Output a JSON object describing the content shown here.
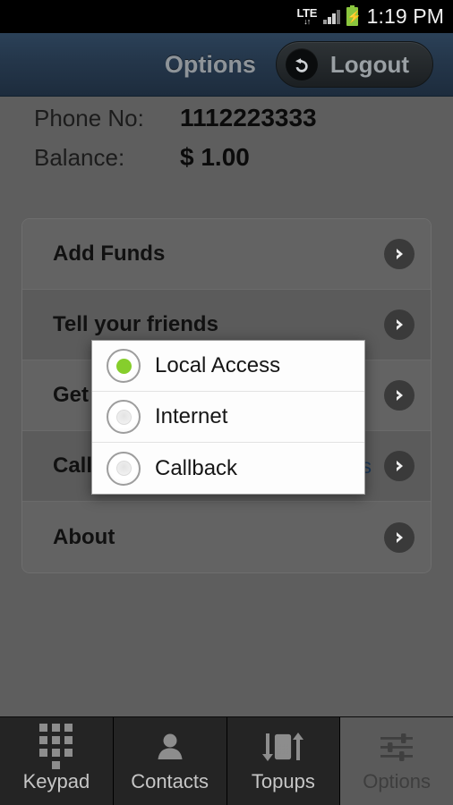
{
  "status_bar": {
    "network_type": "LTE",
    "network_arrows": "↓↑",
    "time": "1:19 PM",
    "battery_icon": "battery-charging-icon",
    "signal_icon": "signal-bars-icon"
  },
  "action_bar": {
    "title": "Options",
    "logout_label": "Logout",
    "logout_icon": "undo-arrow-icon"
  },
  "account": {
    "phone_label": "Phone No:",
    "phone_value": "1112223333",
    "balance_label": "Balance:",
    "balance_value": "$ 1.00"
  },
  "options_list": [
    {
      "label": "Add Funds",
      "value": "",
      "chevron": "chevron-right-icon"
    },
    {
      "label": "Tell your friends",
      "value": "",
      "chevron": "chevron-right-icon"
    },
    {
      "label": "Get Rates",
      "value": "",
      "chevron": "chevron-right-icon"
    },
    {
      "label": "Call Options",
      "value": "Local Access",
      "chevron": "chevron-right-icon"
    },
    {
      "label": "About",
      "value": "",
      "chevron": "chevron-right-icon"
    }
  ],
  "dialog": {
    "options": [
      {
        "label": "Local Access",
        "selected": true
      },
      {
        "label": "Internet",
        "selected": false
      },
      {
        "label": "Callback",
        "selected": false
      }
    ],
    "selected_color": "#86ce2c"
  },
  "tab_bar": {
    "tabs": [
      {
        "label": "Keypad",
        "icon": "keypad-icon",
        "active": false
      },
      {
        "label": "Contacts",
        "icon": "contacts-icon",
        "active": false
      },
      {
        "label": "Topups",
        "icon": "topups-icon",
        "active": false
      },
      {
        "label": "Options",
        "icon": "sliders-icon",
        "active": true
      }
    ]
  },
  "colors": {
    "action_bar": "#24364a",
    "background": "#5e5e5e",
    "accent_green": "#86ce2c",
    "value_blue": "#1d3a5c"
  }
}
